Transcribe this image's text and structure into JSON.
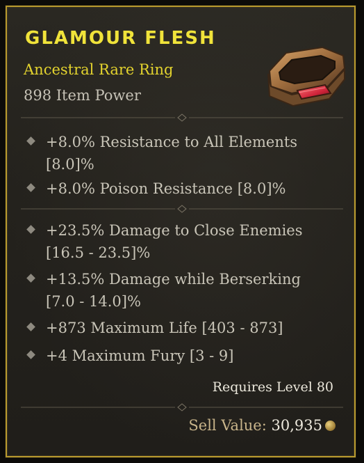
{
  "item": {
    "name": "GLAMOUR FLESH",
    "type": "Ancestral Rare Ring",
    "power": "898 Item Power",
    "image_icon": "ring-icon"
  },
  "implicits": [
    {
      "line1": "+8.0% Resistance to All Elements",
      "line2": "[8.0]%"
    },
    {
      "line1": "+8.0% Poison Resistance [8.0]%",
      "line2": ""
    }
  ],
  "affixes": [
    {
      "line1": "+23.5% Damage to Close Enemies",
      "line2": "[16.5 - 23.5]%"
    },
    {
      "line1": "+13.5% Damage while Berserking",
      "line2": "[7.0 - 14.0]%"
    },
    {
      "line1": "+873 Maximum Life [403 - 873]",
      "line2": ""
    },
    {
      "line1": "+4 Maximum Fury [3 - 9]",
      "line2": ""
    }
  ],
  "requirement": "Requires Level 80",
  "sell": {
    "label": "Sell Value:",
    "value": "30,935",
    "icon": "gold-coin-icon"
  },
  "colors": {
    "rare_yellow": "#f0e33a",
    "border_gold": "#b99a2e",
    "body_text": "#c9c5b8"
  }
}
